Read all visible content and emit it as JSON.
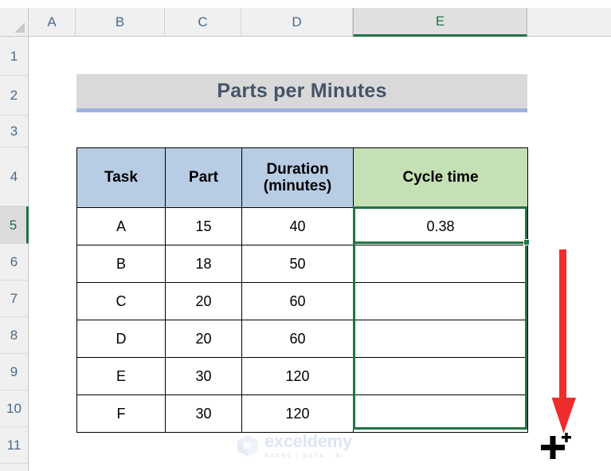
{
  "app": {
    "type": "spreadsheet",
    "select_all_label": "Select All"
  },
  "grid": {
    "column_headers": [
      "A",
      "B",
      "C",
      "D",
      "E"
    ],
    "row_headers": [
      "1",
      "2",
      "3",
      "4",
      "5",
      "6",
      "7",
      "8",
      "9",
      "10",
      "11"
    ],
    "selected_column": "E",
    "selected_row": "5"
  },
  "title_banner": {
    "text": "Parts per Minutes",
    "fill_color": "#d9d9d9",
    "accent_color": "#9cb3de",
    "text_color": "#44546a"
  },
  "table": {
    "headers": [
      {
        "label": "Task",
        "fill": "#b8cce4"
      },
      {
        "label": "Part",
        "fill": "#b8cce4"
      },
      {
        "label": "Duration\n(minutes)",
        "line1": "Duration",
        "line2": "(minutes)",
        "fill": "#b8cce4"
      },
      {
        "label": "Cycle time",
        "fill": "#c5e0b4"
      }
    ],
    "rows": [
      {
        "task": "A",
        "part": "15",
        "duration": "40",
        "cycle_time": "0.38"
      },
      {
        "task": "B",
        "part": "18",
        "duration": "50",
        "cycle_time": ""
      },
      {
        "task": "C",
        "part": "20",
        "duration": "60",
        "cycle_time": ""
      },
      {
        "task": "D",
        "part": "20",
        "duration": "60",
        "cycle_time": ""
      },
      {
        "task": "E",
        "part": "30",
        "duration": "120",
        "cycle_time": ""
      },
      {
        "task": "F",
        "part": "30",
        "duration": "120",
        "cycle_time": ""
      }
    ]
  },
  "selection": {
    "active_cell": "E5",
    "range": "E5:E10",
    "border_color": "#217346",
    "fill_handle_visible": true
  },
  "annotations": {
    "arrow": {
      "direction": "down",
      "color": "#ef2d2d"
    },
    "cursor": {
      "type": "fill-handle-crosshair",
      "glyph": "+",
      "color": "#000000"
    }
  },
  "watermark": {
    "name": "exceldemy",
    "tagline": "EXCEL - DATA - BI"
  }
}
